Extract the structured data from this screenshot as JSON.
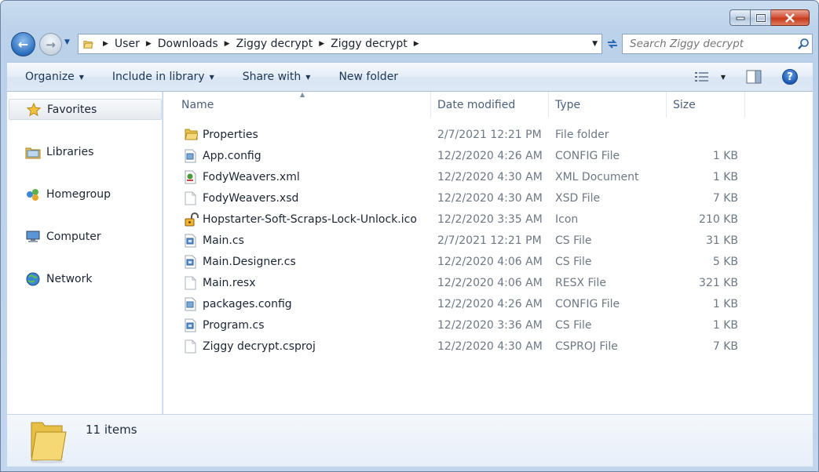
{
  "window": {
    "caption_buttons": [
      "minimize",
      "maximize",
      "close"
    ]
  },
  "nav": {
    "breadcrumb": [
      "User",
      "Downloads",
      "Ziggy decrypt",
      "Ziggy decrypt"
    ],
    "search_placeholder": "Search Ziggy decrypt"
  },
  "toolbar": {
    "organize": "Organize",
    "include_in_library": "Include in library",
    "share_with": "Share with",
    "new_folder": "New folder"
  },
  "sidebar": {
    "items": [
      {
        "label": "Favorites",
        "icon": "star-icon"
      },
      {
        "label": "Libraries",
        "icon": "libraries-icon"
      },
      {
        "label": "Homegroup",
        "icon": "homegroup-icon"
      },
      {
        "label": "Computer",
        "icon": "computer-icon"
      },
      {
        "label": "Network",
        "icon": "network-icon"
      }
    ]
  },
  "columns": {
    "name": "Name",
    "date": "Date modified",
    "type": "Type",
    "size": "Size"
  },
  "files": [
    {
      "name": "Properties",
      "date": "2/7/2021 12:21 PM",
      "type": "File folder",
      "size": "",
      "icon": "folder-icon"
    },
    {
      "name": "App.config",
      "date": "12/2/2020 4:26 AM",
      "type": "CONFIG File",
      "size": "1 KB",
      "icon": "config-file-icon"
    },
    {
      "name": "FodyWeavers.xml",
      "date": "12/2/2020 4:30 AM",
      "type": "XML Document",
      "size": "1 KB",
      "icon": "xml-file-icon"
    },
    {
      "name": "FodyWeavers.xsd",
      "date": "12/2/2020 4:30 AM",
      "type": "XSD File",
      "size": "7 KB",
      "icon": "blank-file-icon"
    },
    {
      "name": "Hopstarter-Soft-Scraps-Lock-Unlock.ico",
      "date": "12/2/2020 3:35 AM",
      "type": "Icon",
      "size": "210 KB",
      "icon": "unlock-icon"
    },
    {
      "name": "Main.cs",
      "date": "2/7/2021 12:21 PM",
      "type": "CS File",
      "size": "31 KB",
      "icon": "cs-file-icon"
    },
    {
      "name": "Main.Designer.cs",
      "date": "12/2/2020 4:06 AM",
      "type": "CS File",
      "size": "5 KB",
      "icon": "cs-file-icon"
    },
    {
      "name": "Main.resx",
      "date": "12/2/2020 4:06 AM",
      "type": "RESX File",
      "size": "321 KB",
      "icon": "blank-file-icon"
    },
    {
      "name": "packages.config",
      "date": "12/2/2020 4:26 AM",
      "type": "CONFIG File",
      "size": "1 KB",
      "icon": "config-file-icon"
    },
    {
      "name": "Program.cs",
      "date": "12/2/2020 3:36 AM",
      "type": "CS File",
      "size": "1 KB",
      "icon": "cs-file-icon"
    },
    {
      "name": "Ziggy decrypt.csproj",
      "date": "12/2/2020 4:30 AM",
      "type": "CSPROJ File",
      "size": "7 KB",
      "icon": "blank-file-icon"
    }
  ],
  "details": {
    "count": "11 items"
  },
  "colors": {
    "accent": "#2b6fc0",
    "folder": "#e8c14f",
    "close": "#c53a1c"
  }
}
